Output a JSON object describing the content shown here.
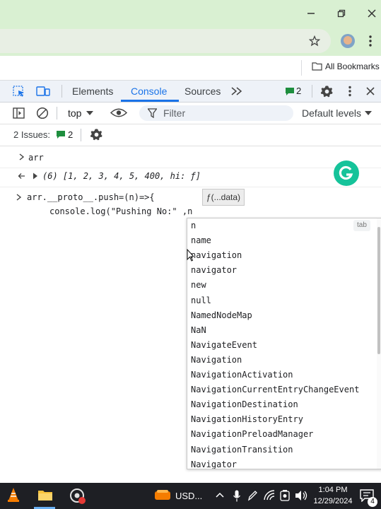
{
  "window": {
    "minimize_icon": "minimize-icon",
    "restore_icon": "restore-icon",
    "close_icon": "close-icon"
  },
  "browser": {
    "bookmarks_label": "All Bookmarks"
  },
  "devtools": {
    "tabs": [
      "Elements",
      "Console",
      "Sources"
    ],
    "active_tab": "Console",
    "issues_badge": "2"
  },
  "console_toolbar": {
    "context": "top",
    "filter_placeholder": "Filter",
    "levels": "Default levels"
  },
  "issues_bar": {
    "label": "2 Issues:",
    "count": "2"
  },
  "console": {
    "line1_input": "arr",
    "line2_output": "(6) [1, 2, 3, 4, 5, 400, hi: ƒ]",
    "line3_input_a": "arr.__proto__.push=(n)=>{",
    "line3_input_b": "console.log(\"Pushing No:\" ,n",
    "hint": "ƒ(...data)"
  },
  "autocomplete": {
    "tab_hint": "tab",
    "items": [
      "n",
      "name",
      "navigation",
      "navigator",
      "new",
      "null",
      "NamedNodeMap",
      "NaN",
      "NavigateEvent",
      "Navigation",
      "NavigationActivation",
      "NavigationCurrentEntryChangeEvent",
      "NavigationDestination",
      "NavigationHistoryEntry",
      "NavigationPreloadManager",
      "NavigationTransition",
      "Navigator"
    ]
  },
  "taskbar": {
    "app_label": "USD...",
    "time": "1:04 PM",
    "date": "12/29/2024",
    "notification_count": "4"
  },
  "colors": {
    "titlebar": "#d9f0d2",
    "accent_blue": "#1a73e8",
    "grammarly_green": "#15c39a",
    "taskbar": "#1e1f24"
  }
}
